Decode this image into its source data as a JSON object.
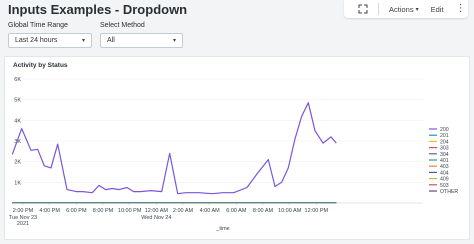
{
  "page": {
    "title": "Inputs Examples - Dropdown"
  },
  "header": {
    "actions_label": "Actions",
    "edit_label": "Edit",
    "more_label": "⋮"
  },
  "inputs": {
    "time_range": {
      "label": "Global Time Range",
      "value": "Last 24 hours"
    },
    "method": {
      "label": "Select Method",
      "value": "All"
    }
  },
  "panel": {
    "title": "Activity by Status"
  },
  "chart_data": {
    "type": "line",
    "title": "Activity by Status",
    "xlabel": "_time",
    "ylabel": "",
    "ylim": [
      0,
      6000
    ],
    "y_ticks": [
      {
        "value": 1000,
        "label": "1K"
      },
      {
        "value": 2000,
        "label": "2K"
      },
      {
        "value": 3000,
        "label": "3K"
      },
      {
        "value": 4000,
        "label": "4K"
      },
      {
        "value": 5000,
        "label": "5K"
      },
      {
        "value": 6000,
        "label": "6K"
      }
    ],
    "x_range": [
      0,
      30
    ],
    "x_ticks": [
      {
        "x": 0,
        "label": "2:00 PM",
        "sub": [
          "Tue Nov 23",
          "2021"
        ]
      },
      {
        "x": 2,
        "label": "4:00 PM",
        "sub": []
      },
      {
        "x": 4,
        "label": "6:00 PM",
        "sub": []
      },
      {
        "x": 6,
        "label": "8:00 PM",
        "sub": []
      },
      {
        "x": 8,
        "label": "10:00 PM",
        "sub": []
      },
      {
        "x": 10,
        "label": "12:00 AM",
        "sub": [
          "Wed Nov 24"
        ]
      },
      {
        "x": 12,
        "label": "2:00 AM",
        "sub": []
      },
      {
        "x": 14,
        "label": "4:00 AM",
        "sub": []
      },
      {
        "x": 16,
        "label": "6:00 AM",
        "sub": []
      },
      {
        "x": 18,
        "label": "8:00 AM",
        "sub": []
      },
      {
        "x": 20,
        "label": "10:00 AM",
        "sub": []
      },
      {
        "x": 22,
        "label": "12:00 PM",
        "sub": []
      }
    ],
    "legend_position": "right",
    "series": [
      {
        "name": "200",
        "color": "#7b56db",
        "x": [
          -0.8,
          -0.1,
          0.6,
          1.1,
          1.6,
          2.1,
          2.6,
          3.3,
          4.0,
          4.5,
          5.2,
          5.7,
          6.2,
          6.7,
          7.2,
          7.8,
          8.3,
          8.8,
          9.6,
          10.4,
          11.0,
          11.6,
          12.2,
          13.2,
          14.2,
          15.0,
          15.8,
          16.8,
          17.6,
          18.4,
          18.9,
          19.4,
          19.9,
          20.4,
          20.9,
          21.4,
          21.9,
          22.5,
          23.1,
          23.5
        ],
        "values": [
          2350,
          3600,
          2550,
          2600,
          1800,
          1700,
          2850,
          650,
          550,
          550,
          500,
          850,
          650,
          700,
          650,
          750,
          550,
          550,
          600,
          550,
          2400,
          450,
          500,
          500,
          450,
          500,
          500,
          750,
          1450,
          2100,
          800,
          1000,
          1700,
          3100,
          4200,
          4850,
          3500,
          2900,
          3200,
          2900
        ]
      },
      {
        "name": "201",
        "color": "#1e93c6",
        "x": [
          -0.8,
          23.5
        ],
        "values": [
          20,
          20
        ]
      },
      {
        "name": "204",
        "color": "#f2b827",
        "x": [
          -0.8,
          23.5
        ],
        "values": [
          15,
          15
        ]
      },
      {
        "name": "303",
        "color": "#d6563c",
        "x": [
          -0.8,
          23.5
        ],
        "values": [
          10,
          10
        ]
      },
      {
        "name": "304",
        "color": "#6a5c9e",
        "x": [
          -0.8,
          23.5
        ],
        "values": [
          10,
          10
        ]
      },
      {
        "name": "401",
        "color": "#31a35f",
        "x": [
          -0.8,
          23.5
        ],
        "values": [
          10,
          10
        ]
      },
      {
        "name": "403",
        "color": "#ed8440",
        "x": [
          -0.8,
          23.5
        ],
        "values": [
          10,
          10
        ]
      },
      {
        "name": "404",
        "color": "#3863a0",
        "x": [
          -0.8,
          23.5
        ],
        "values": [
          30,
          30
        ]
      },
      {
        "name": "409",
        "color": "#a2cc3e",
        "x": [
          -0.8,
          23.5
        ],
        "values": [
          10,
          10
        ]
      },
      {
        "name": "503",
        "color": "#cc5068",
        "x": [
          -0.8,
          23.5
        ],
        "values": [
          10,
          10
        ]
      },
      {
        "name": "OTHER",
        "color": "#73427f",
        "x": [
          -0.8,
          23.5
        ],
        "values": [
          10,
          10
        ]
      }
    ]
  }
}
